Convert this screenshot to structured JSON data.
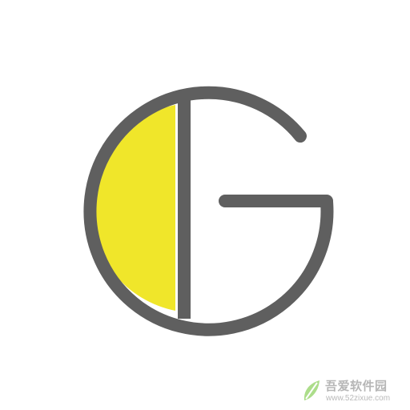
{
  "logo": {
    "name": "G half-yellow logo",
    "colors": {
      "stroke": "#5f5f5f",
      "fill": "#f0e62a",
      "background": "#ffffff"
    }
  },
  "watermark": {
    "icon": "leaf-icon",
    "title": "吾爱软件园",
    "url": "www.52zixue.com"
  }
}
